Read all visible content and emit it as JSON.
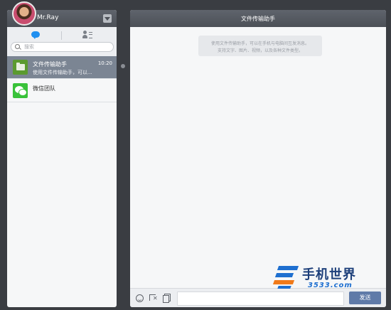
{
  "user": {
    "name": "Mr.Ray"
  },
  "search": {
    "placeholder": "搜索"
  },
  "conversations": [
    {
      "name": "文件传输助手",
      "preview": "使用文件传输助手，可以...",
      "time": "10:20",
      "selected": true,
      "avatar_icon": "folder-icon"
    },
    {
      "name": "微信团队",
      "preview": "",
      "time": "",
      "selected": false,
      "avatar_icon": "wechat-icon"
    }
  ],
  "chat": {
    "title": "文件传输助手",
    "notice_line1": "使用文件传输助手，可以在手机与电脑间互发消息。",
    "notice_line2": "支持文字、图片、视频，以及各种文件类型。"
  },
  "composer": {
    "send_label": "发送",
    "tools": [
      "emoji-icon",
      "screenshot-icon",
      "file-icon"
    ]
  },
  "watermark": {
    "brand": "手机世界",
    "domain": "3533.com"
  },
  "colors": {
    "header_bg": "#565a61",
    "selected_row": "#7b8593",
    "send_button": "#5f7aa8",
    "chat_tab_active": "#1f8ff0"
  }
}
